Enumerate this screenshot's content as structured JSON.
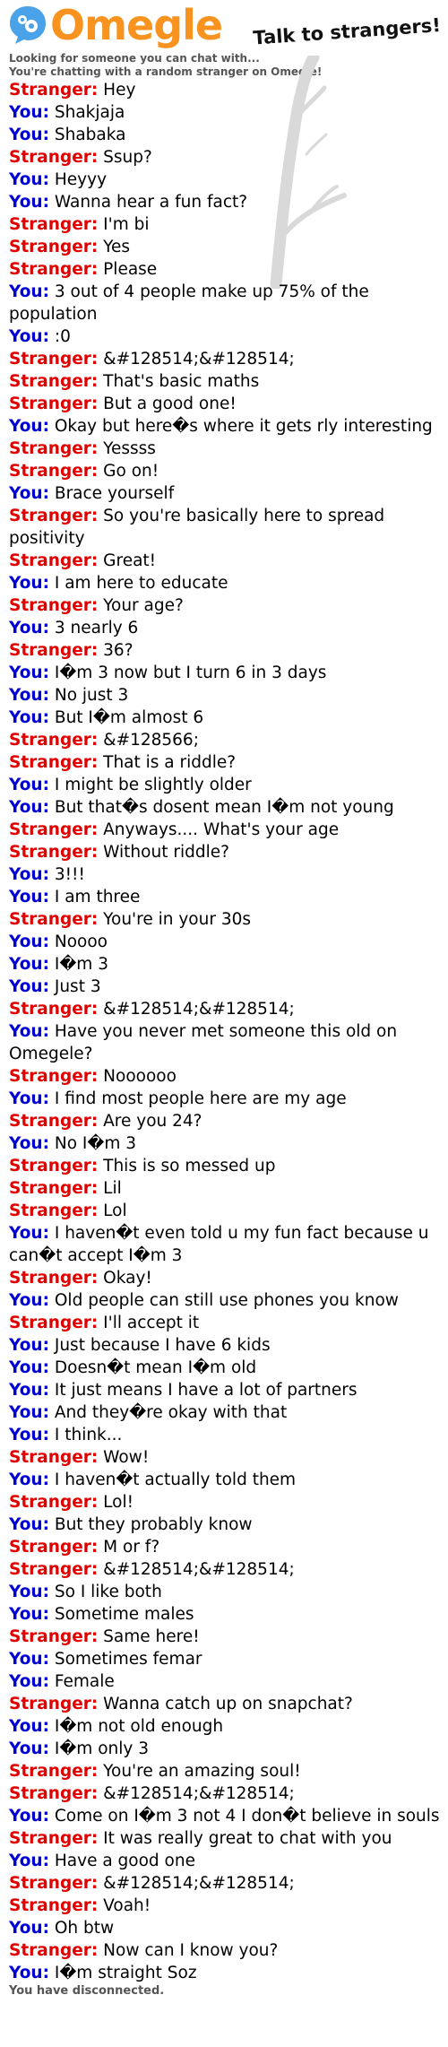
{
  "header": {
    "logo_text": "Omegle",
    "tagline": "Talk to strangers!"
  },
  "status": {
    "looking": "Looking for someone you can chat with...",
    "connected": "You're chatting with a random stranger on Omegle!",
    "disconnected": "You have disconnected."
  },
  "labels": {
    "stranger": "Stranger:",
    "you": "You:"
  },
  "colors": {
    "stranger": "#e00000",
    "you": "#0000d4",
    "logo": "#f7931e",
    "bubble": "#4aa3e8"
  },
  "messages": [
    {
      "who": "stranger",
      "text": "Hey"
    },
    {
      "who": "you",
      "text": "Shakjaja"
    },
    {
      "who": "you",
      "text": "Shabaka"
    },
    {
      "who": "stranger",
      "text": "Ssup?"
    },
    {
      "who": "you",
      "text": "Heyyy"
    },
    {
      "who": "you",
      "text": "Wanna hear a fun fact?"
    },
    {
      "who": "stranger",
      "text": "I'm bi"
    },
    {
      "who": "stranger",
      "text": "Yes"
    },
    {
      "who": "stranger",
      "text": "Please"
    },
    {
      "who": "you",
      "text": "3 out of 4 people make up 75% of the population"
    },
    {
      "who": "you",
      "text": ":0"
    },
    {
      "who": "stranger",
      "text": "&#128514;&#128514;"
    },
    {
      "who": "stranger",
      "text": "That's basic maths"
    },
    {
      "who": "stranger",
      "text": "But a good one!"
    },
    {
      "who": "you",
      "text": "Okay but here�s where it gets rly interesting"
    },
    {
      "who": "stranger",
      "text": "Yessss"
    },
    {
      "who": "stranger",
      "text": "Go on!"
    },
    {
      "who": "you",
      "text": "Brace yourself"
    },
    {
      "who": "stranger",
      "text": "So you're basically here to spread positivity"
    },
    {
      "who": "stranger",
      "text": "Great!"
    },
    {
      "who": "you",
      "text": "I am here to educate"
    },
    {
      "who": "stranger",
      "text": "Your age?"
    },
    {
      "who": "you",
      "text": "3 nearly 6"
    },
    {
      "who": "stranger",
      "text": "36?"
    },
    {
      "who": "you",
      "text": "I�m 3 now but I turn 6 in 3 days"
    },
    {
      "who": "you",
      "text": "No just 3"
    },
    {
      "who": "you",
      "text": "But I�m almost 6"
    },
    {
      "who": "stranger",
      "text": "&#128566;"
    },
    {
      "who": "stranger",
      "text": "That is a riddle?"
    },
    {
      "who": "you",
      "text": "I might be slightly older"
    },
    {
      "who": "you",
      "text": "But that�s dosent mean I�m not young"
    },
    {
      "who": "stranger",
      "text": "Anyways.... What's your age"
    },
    {
      "who": "stranger",
      "text": "Without riddle?"
    },
    {
      "who": "you",
      "text": "3!!!"
    },
    {
      "who": "you",
      "text": "I am three"
    },
    {
      "who": "stranger",
      "text": "You're in your 30s"
    },
    {
      "who": "you",
      "text": "Noooo"
    },
    {
      "who": "you",
      "text": "I�m 3"
    },
    {
      "who": "you",
      "text": "Just 3"
    },
    {
      "who": "stranger",
      "text": "&#128514;&#128514;"
    },
    {
      "who": "you",
      "text": "Have you never met someone this old on Omegele?"
    },
    {
      "who": "stranger",
      "text": "Noooooo"
    },
    {
      "who": "you",
      "text": "I find most people here are my age"
    },
    {
      "who": "stranger",
      "text": "Are you 24?"
    },
    {
      "who": "you",
      "text": "No I�m 3"
    },
    {
      "who": "stranger",
      "text": "This is so messed up"
    },
    {
      "who": "stranger",
      "text": "Lil"
    },
    {
      "who": "stranger",
      "text": "Lol"
    },
    {
      "who": "you",
      "text": "I haven�t even told u my fun fact because u can�t accept I�m 3"
    },
    {
      "who": "stranger",
      "text": "Okay!"
    },
    {
      "who": "you",
      "text": "Old people can still use phones you know"
    },
    {
      "who": "stranger",
      "text": "I'll accept it"
    },
    {
      "who": "you",
      "text": "Just because I have 6 kids"
    },
    {
      "who": "you",
      "text": "Doesn�t mean I�m old"
    },
    {
      "who": "you",
      "text": "It just means I have a lot of partners"
    },
    {
      "who": "you",
      "text": "And they�re okay with that"
    },
    {
      "who": "you",
      "text": "I think..."
    },
    {
      "who": "stranger",
      "text": "Wow!"
    },
    {
      "who": "you",
      "text": "I haven�t actually told them"
    },
    {
      "who": "stranger",
      "text": "Lol!"
    },
    {
      "who": "you",
      "text": "But they probably know"
    },
    {
      "who": "stranger",
      "text": "M or f?"
    },
    {
      "who": "stranger",
      "text": "&#128514;&#128514;"
    },
    {
      "who": "you",
      "text": "So I like both"
    },
    {
      "who": "you",
      "text": "Sometime males"
    },
    {
      "who": "stranger",
      "text": "Same here!"
    },
    {
      "who": "you",
      "text": "Sometimes femar"
    },
    {
      "who": "you",
      "text": "Female"
    },
    {
      "who": "stranger",
      "text": "Wanna catch up on snapchat?"
    },
    {
      "who": "you",
      "text": "I�m not old enough"
    },
    {
      "who": "you",
      "text": "I�m only 3"
    },
    {
      "who": "stranger",
      "text": "You're an amazing soul!"
    },
    {
      "who": "stranger",
      "text": "&#128514;&#128514;"
    },
    {
      "who": "you",
      "text": "Come on I�m 3 not 4 I don�t believe in souls"
    },
    {
      "who": "stranger",
      "text": "It was really great to chat with you"
    },
    {
      "who": "you",
      "text": "Have a good one"
    },
    {
      "who": "stranger",
      "text": "&#128514;&#128514;"
    },
    {
      "who": "stranger",
      "text": "Voah!"
    },
    {
      "who": "you",
      "text": "Oh btw"
    },
    {
      "who": "stranger",
      "text": "Now can I know you?"
    },
    {
      "who": "you",
      "text": "I�m straight Soz"
    }
  ]
}
